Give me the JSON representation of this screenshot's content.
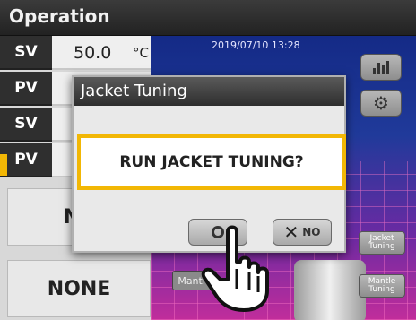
{
  "header": {
    "title": "Operation"
  },
  "left_panel": {
    "rows": [
      {
        "label": "SV",
        "value": "50.0",
        "unit": "°C"
      },
      {
        "label": "PV"
      },
      {
        "label": "SV"
      },
      {
        "label": "PV"
      }
    ],
    "mode_buttons": [
      "NC",
      "NONE"
    ]
  },
  "display": {
    "datetime": "2019/07/10 13:28",
    "mantle_chip": "Mantle"
  },
  "side_buttons": {
    "chart_icon": "bar-chart-icon",
    "settings_icon": "gear-icon",
    "jacket_tuning": "Jacket Tuning",
    "mantle_tuning": "Mantle Tuning"
  },
  "dialog": {
    "title": "Jacket Tuning",
    "message": "RUN JACKET TUNING?",
    "ok_icon": "circle-icon",
    "no_icon": "x-icon",
    "no_label": "NO"
  },
  "colors": {
    "highlight": "#f2b705",
    "title_bar": "#2e2e2e",
    "display_top": "#142a86",
    "display_bottom": "#c12d9b"
  }
}
